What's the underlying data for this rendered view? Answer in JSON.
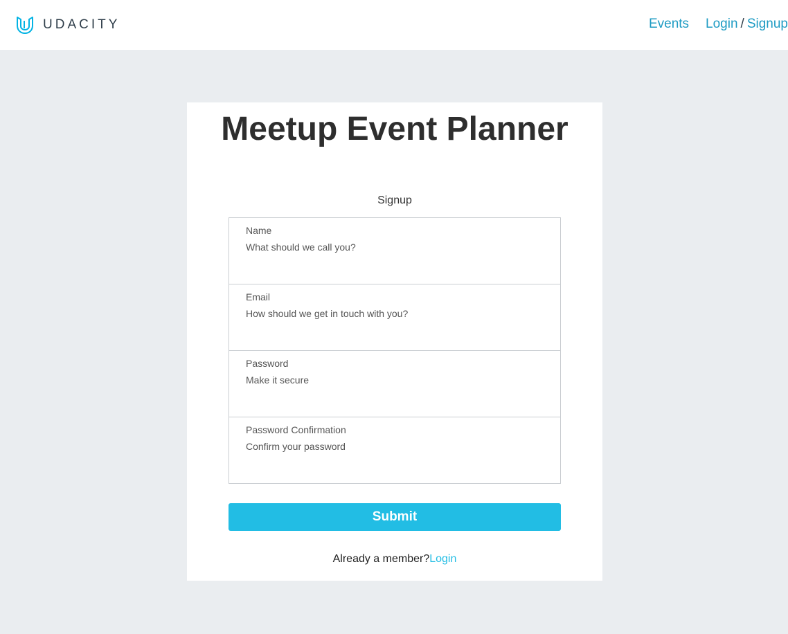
{
  "header": {
    "logo_text": "UDACITY",
    "nav": {
      "events": "Events",
      "login": "Login",
      "separator": "/",
      "signup": "Signup"
    }
  },
  "card": {
    "title": "Meetup Event Planner",
    "subtitle": "Signup",
    "fields": [
      {
        "label": "Name",
        "placeholder": "What should we call you?",
        "value": ""
      },
      {
        "label": "Email",
        "placeholder": "How should we get in touch with you?",
        "value": ""
      },
      {
        "label": "Password",
        "placeholder": "Make it secure",
        "value": ""
      },
      {
        "label": "Password Confirmation",
        "placeholder": "Confirm your password",
        "value": ""
      }
    ],
    "submit_label": "Submit",
    "member_text": "Already a member?",
    "member_link": "Login"
  },
  "colors": {
    "brand": "#02b3e4",
    "link": "#1e9bc3",
    "button": "#22bde4",
    "background": "#eaedf0"
  },
  "icons": {
    "logo": "udacity-logo-icon"
  }
}
